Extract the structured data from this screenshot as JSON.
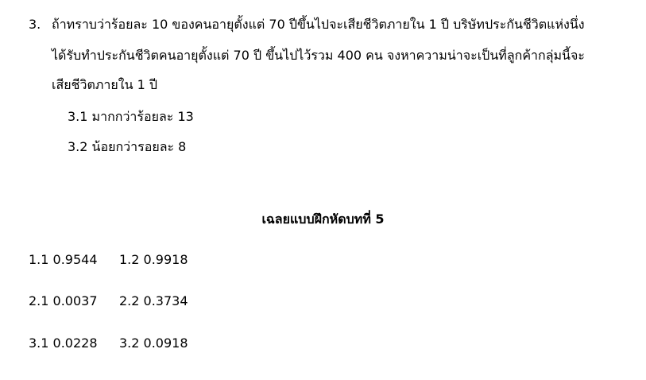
{
  "question": {
    "number": "3.",
    "lines": [
      "ถ้าทราบว่าร้อยละ 10 ของคนอายุตั้งแต่ 70 ปีขึ้นไปจะเสียชีวิตภายใน 1 ปี บริษัทประกันชีวิตแห่งนึ่ง",
      "ได้รับทำประกันชีวิตคนอายุตั้งแต่ 70 ปี ขึ้นไปไว้รวม 400 คน จงหาความน่าจะเป็นที่ลูกค้ากลุ่มนี้จะ",
      "เสียชีวิตภายใน 1 ปี"
    ],
    "sub_items": [
      "3.1 มากกว่าร้อยละ 13",
      "3.2 น้อยกว่ารอยละ 8"
    ]
  },
  "answers": {
    "title": "เฉลยแบบฝึกหัดบทที่ 5",
    "rows": [
      [
        "1.1 0.9544",
        "1.2 0.9918"
      ],
      [
        "2.1 0.0037",
        "2.2 0.3734"
      ],
      [
        "3.1 0.0228",
        "3.2 0.0918"
      ]
    ]
  }
}
